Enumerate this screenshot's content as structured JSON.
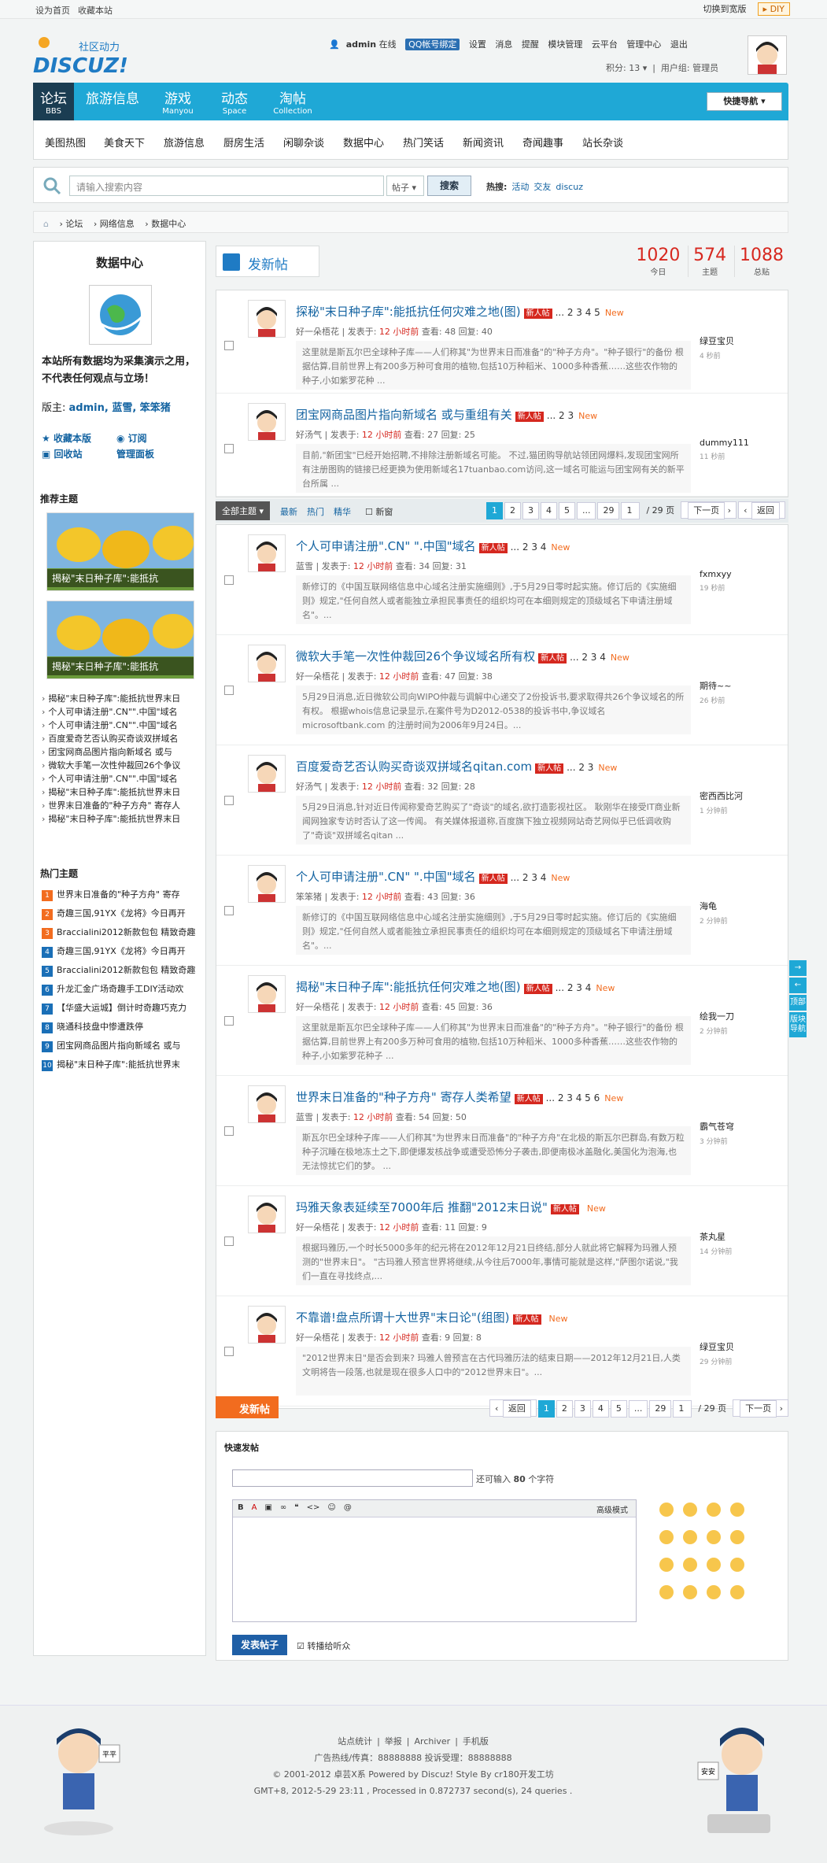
{
  "topbar": {
    "set_home": "设为首页",
    "bookmark": "收藏本站",
    "switch_width": "切换到宽版",
    "diy": "DIY"
  },
  "logo": {
    "tagline": "社区动力",
    "name": "DISCUZ!"
  },
  "user": {
    "name": "admin",
    "status": "在线",
    "qq_label": "QQ帐号绑定",
    "links": [
      "设置",
      "消息",
      "提醒",
      "模块管理",
      "云平台",
      "管理中心",
      "退出"
    ],
    "points": "积分: 13",
    "group": "用户组: 管理员"
  },
  "nav": {
    "items": [
      {
        "title": "论坛",
        "sub": "BBS"
      },
      {
        "title": "旅游信息",
        "sub": ""
      },
      {
        "title": "游戏",
        "sub": "Manyou"
      },
      {
        "title": "动态",
        "sub": "Space"
      },
      {
        "title": "淘帖",
        "sub": "Collection"
      }
    ],
    "quick_nav": "快捷导航"
  },
  "subnav": [
    "美图热图",
    "美食天下",
    "旅游信息",
    "厨房生活",
    "闲聊杂谈",
    "数据中心",
    "热门笑话",
    "新闻资讯",
    "奇闻趣事",
    "站长杂谈"
  ],
  "search": {
    "placeholder": "请输入搜索内容",
    "scope": "帖子",
    "button": "搜索",
    "hot_label": "热搜:",
    "hot_words": [
      "活动",
      "交友",
      "discuz"
    ]
  },
  "breadcrumb": [
    "论坛",
    "网络信息",
    "数据中心"
  ],
  "sidebar": {
    "title": "数据中心",
    "desc": "本站所有数据均为采集演示之用，不代表任何观点与立场！",
    "mods_label": "版主:",
    "mods": "admin, 蓝雪, 笨笨猪",
    "links": [
      "收藏本版",
      "订阅",
      "回收站",
      "管理面板"
    ],
    "rec_title": "推荐主题",
    "pic_caps": [
      "揭秘\"末日种子库\":能抵抗",
      "揭秘\"末日种子库\":能抵抗"
    ],
    "rec_list": [
      "揭秘\"末日种子库\":能抵抗世界末日",
      "个人可申请注册\".CN\"\".中国\"域名",
      "个人可申请注册\".CN\"\".中国\"域名",
      "百度爱奇艺否认购买奇谈双拼域名",
      "团宝网商品图片指向新域名 或与",
      "微软大手笔一次性仲裁回26个争议",
      "个人可申请注册\".CN\"\".中国\"域名",
      "揭秘\"末日种子库\":能抵抗世界末日",
      "世界末日准备的\"种子方舟\" 寄存人",
      "揭秘\"末日种子库\":能抵抗世界末日"
    ],
    "hot_title": "热门主题",
    "hot_list": [
      "世界末日准备的\"种子方舟\" 寄存",
      "奇趣三国,91YX《龙将》今日再开",
      "Braccialini2012新款包包 精致奇趣",
      "奇趣三国,91YX《龙将》今日再开",
      "Braccialini2012新款包包 精致奇趣",
      "升龙汇金广场奇趣手工DIY活动欢",
      "【华盛大运城】倒计时奇趣巧克力",
      "晓通科技盘中惨遭跌停",
      "团宝网商品图片指向新域名 或与",
      "揭秘\"末日种子库\":能抵抗世界末"
    ]
  },
  "main": {
    "new_post": "发新帖",
    "stats": [
      {
        "value": "1020",
        "label": "今日"
      },
      {
        "value": "574",
        "label": "主题"
      },
      {
        "value": "1088",
        "label": "总贴"
      }
    ],
    "filter": {
      "all": "全部主题",
      "items": [
        "最新",
        "热门",
        "精华",
        "新窗"
      ]
    },
    "pager": {
      "back": "返回",
      "pages": [
        "1",
        "2",
        "3",
        "4",
        "5",
        "...",
        "29"
      ],
      "jump": "1",
      "total": "/ 29 页",
      "next": "下一页"
    },
    "new_badge": "新人帖",
    "new_flag": "New",
    "threads_top": [
      {
        "title": "探秘\"末日种子库\":能抵抗任何灾难之地(图)",
        "pages": "... 2 3 4 5",
        "author": "好一朵梧花",
        "time": "12 小时前",
        "views": "48",
        "replies": "40",
        "summary": "这里就是斯瓦尔巴全球种子库——人们称其\"为世界末日而准备\"的\"种子方舟\"。\"种子银行\"的备份 根据估算,目前世界上有200多万种可食用的植物,包括10万种稻米、1000多种香蕉……这些农作物的种子,小如紫罗花种 ...",
        "last_user": "绿豆宝贝",
        "last_time": "4 秒前"
      },
      {
        "title": "团宝网商品图片指向新域名 或与重组有关",
        "pages": "... 2 3",
        "author": "好汤气",
        "time": "12 小时前",
        "views": "27",
        "replies": "25",
        "summary": "目前,\"新团宝\"已经开始招聘,不排除注册新域名可能。 不过,猫团购导航站领团网爆料,发现团宝网所有注册图购的链接已经更换为使用新域名17tuanbao.com访问,这一域名可能运与团宝网有关的新平台所属 ...",
        "last_user": "dummy111",
        "last_time": "11 秒前"
      }
    ],
    "threads_bottom": [
      {
        "title": "个人可申请注册\".CN\" \".中国\"域名",
        "pages": "... 2 3 4",
        "author": "蓝雪",
        "time": "12 小时前",
        "views": "34",
        "replies": "31",
        "summary": "新修订的《中国互联网络信息中心域名注册实施细则》,于5月29日零时起实施。修订后的《实施细则》规定,\"任何自然人或者能独立承担民事责任的组织均可在本细则规定的顶级域名下申请注册域名\"。...",
        "last_user": "fxmxyy",
        "last_time": "19 秒前"
      },
      {
        "title": "微软大手笔一次性仲裁回26个争议域名所有权",
        "pages": "... 2 3 4",
        "author": "好一朵梧花",
        "time": "12 小时前",
        "views": "47",
        "replies": "38",
        "summary": "5月29日消息,近日微软公司向WIPO仲裁与调解中心递交了2份投诉书,要求取得共26个争议域名的所有权。 根据whois信息记录显示,在案件号为D2012-0538的投诉书中,争议域名microsoftbank.com 的注册时间为2006年9月24日。...",
        "last_user": "期待~~",
        "last_time": "26 秒前"
      },
      {
        "title": "百度爱奇艺否认购买奇谈双拼域名qitan.com",
        "pages": "... 2 3",
        "author": "好汤气",
        "time": "12 小时前",
        "views": "32",
        "replies": "28",
        "summary": "5月29日消息,针对近日传闻称爱奇艺购买了\"奇谈\"的域名,欲打造影视社区。 耿刚华在接受IT商业新闻网独家专访时否认了这一传闻。 有关媒体报道称,百度旗下独立视频网站奇艺网似乎已低调收购了\"奇谈\"双拼域名qitan ...",
        "last_user": "密西西比河",
        "last_time": "1 分钟前"
      },
      {
        "title": "个人可申请注册\".CN\" \".中国\"域名",
        "pages": "... 2 3 4",
        "author": "笨笨猪",
        "time": "12 小时前",
        "views": "43",
        "replies": "36",
        "summary": "新修订的《中国互联网络信息中心域名注册实施细则》,于5月29日零时起实施。修订后的《实施细则》规定,\"任何自然人或者能独立承担民事责任的组织均可在本细则规定的顶级域名下申请注册域名\"。...",
        "last_user": "海龟",
        "last_time": "2 分钟前"
      },
      {
        "title": "揭秘\"末日种子库\":能抵抗任何灾难之地(图)",
        "pages": "... 2 3 4",
        "author": "好一朵梧花",
        "time": "12 小时前",
        "views": "45",
        "replies": "36",
        "summary": "这里就是斯瓦尔巴全球种子库——人们称其\"为世界末日而准备\"的\"种子方舟\"。\"种子银行\"的备份 根据估算,目前世界上有200多万种可食用的植物,包括10万种稻米、1000多种香蕉……这些农作物的种子,小如紫罗花种子 ...",
        "last_user": "绘我一刀",
        "last_time": "2 分钟前"
      },
      {
        "title": "世界末日准备的\"种子方舟\" 寄存人类希望",
        "pages": "... 2 3 4 5 6",
        "author": "蓝雪",
        "time": "12 小时前",
        "views": "54",
        "replies": "50",
        "summary": "斯瓦尔巴全球种子库——人们称其\"为世界末日而准备\"的\"种子方舟\"在北极的斯瓦尔巴群岛,有数万粒种子沉睡在极地冻土之下,即便爆发核战争或遭受恐怖分子袭击,即便南极冰盖融化,美国化为泡海,也无法惊扰它们的梦。 ...",
        "last_user": "霸气苍穹",
        "last_time": "3 分钟前"
      },
      {
        "title": "玛雅天象表延续至7000年后 推翻\"2012末日说\"",
        "pages": "",
        "author": "好一朵梧花",
        "time": "12 小时前",
        "views": "11",
        "replies": "9",
        "summary": "根据玛雅历,一个时长5000多年的纪元将在2012年12月21日终结,部分人就此将它解释为玛雅人预测的\"世界末日\"。 \"古玛雅人预言世界将继续,从今往后7000年,事情可能就是这样,\"萨图尔诺说,\"我们一直在寻找终点,...",
        "last_user": "茶丸星",
        "last_time": "14 分钟前"
      },
      {
        "title": "不靠谱!盘点所谓十大世界\"末日论\"(组图)",
        "pages": "",
        "author": "好一朵梧花",
        "time": "12 小时前",
        "views": "9",
        "replies": "8",
        "summary": "\"2012世界末日\"是否会到来? 玛雅人曾预言在古代玛雅历法的结束日期——2012年12月21日,人类文明将告一段落,也就是现在很多人口中的\"2012世界末日\"。...",
        "last_user": "绿豆宝贝",
        "last_time": "29 分钟前"
      }
    ],
    "meta_labels": {
      "posted": "发表于:",
      "views": "查看:",
      "replies": "回复:"
    },
    "bottom_pager": {
      "back": "返回",
      "pages": [
        "1",
        "2",
        "3",
        "4",
        "5",
        "...",
        "29"
      ],
      "jump": "1",
      "total": "/ 29 页",
      "next": "下一页"
    },
    "quickpost": {
      "title": "快速发帖",
      "remain_prefix": "还可输入",
      "remain_num": "80",
      "remain_suffix": "个字符",
      "advanced": "高级模式",
      "post_btn": "发表帖子",
      "checkbox": "转播给听众"
    }
  },
  "sidetool": [
    "顶部",
    "版块导航"
  ],
  "footer": {
    "links": [
      "站点统计",
      "举报",
      "Archiver",
      "手机版"
    ],
    "ad_line": "广告热线/传真：88888888   投诉受理：88888888",
    "copyright": "© 2001-2012 卓芸X系 Powered by Discuz! Style By cr180开发工坊",
    "stats": "GMT+8, 2012-5-29 23:11 , Processed in 0.872737 second(s), 24 queries .",
    "left_char": "平平",
    "right_char": "安安"
  }
}
